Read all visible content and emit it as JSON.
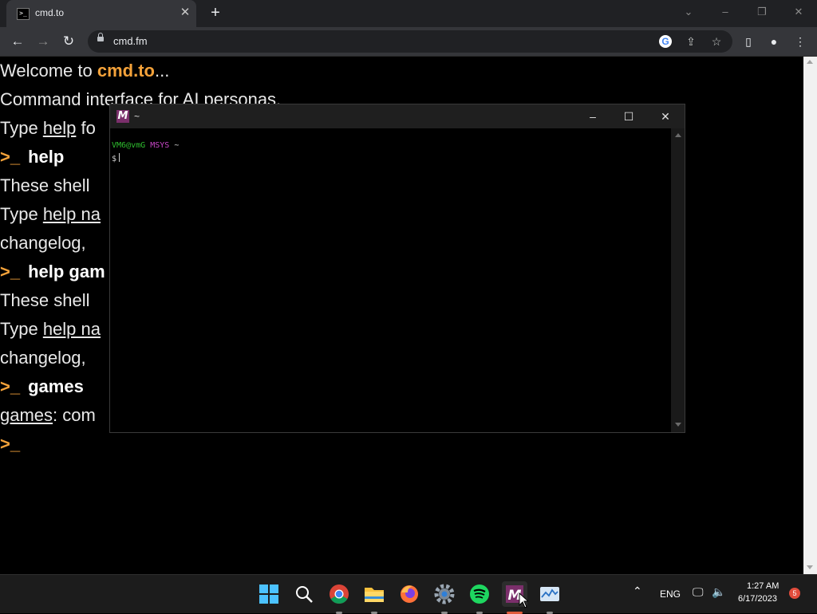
{
  "browser": {
    "tab_title": "cmd.to",
    "url": "cmd.fm",
    "tab_favicon_text": ">_"
  },
  "page": {
    "welcome_prefix": "Welcome to ",
    "welcome_brand": "cmd.to",
    "welcome_suffix": "...",
    "tagline": "Command interface for AI personas.",
    "type_help_prefix": "Type ",
    "type_help_link": "help",
    "type_help_suffix": " fo",
    "prompt": ">_",
    "cmd1": "help",
    "shell_text_1": "These shell ",
    "type_help_name_1_prefix": "Type ",
    "type_help_name_1_link": "help na",
    "changelog_1": "changelog, ",
    "cmd2": "help gam",
    "shell_text_2": "These shell ",
    "type_help_name_2_prefix": "Type ",
    "type_help_name_2_link": "help na",
    "changelog_2": "changelog, ",
    "cmd3": "games",
    "games_link": "games",
    "games_suffix": ": com",
    "final_prompt": ">_"
  },
  "terminal": {
    "title": "~",
    "user_host": "VM6@vmG",
    "system": "MSYS",
    "path": "~",
    "prompt_symbol": "$"
  },
  "taskbar": {
    "language": "ENG",
    "time": "1:27 AM",
    "date": "6/17/2023",
    "notification_count": "5"
  },
  "colors": {
    "accent_orange": "#f4a23a",
    "terminal_green": "#2fbf2f",
    "terminal_magenta": "#c847c8"
  }
}
